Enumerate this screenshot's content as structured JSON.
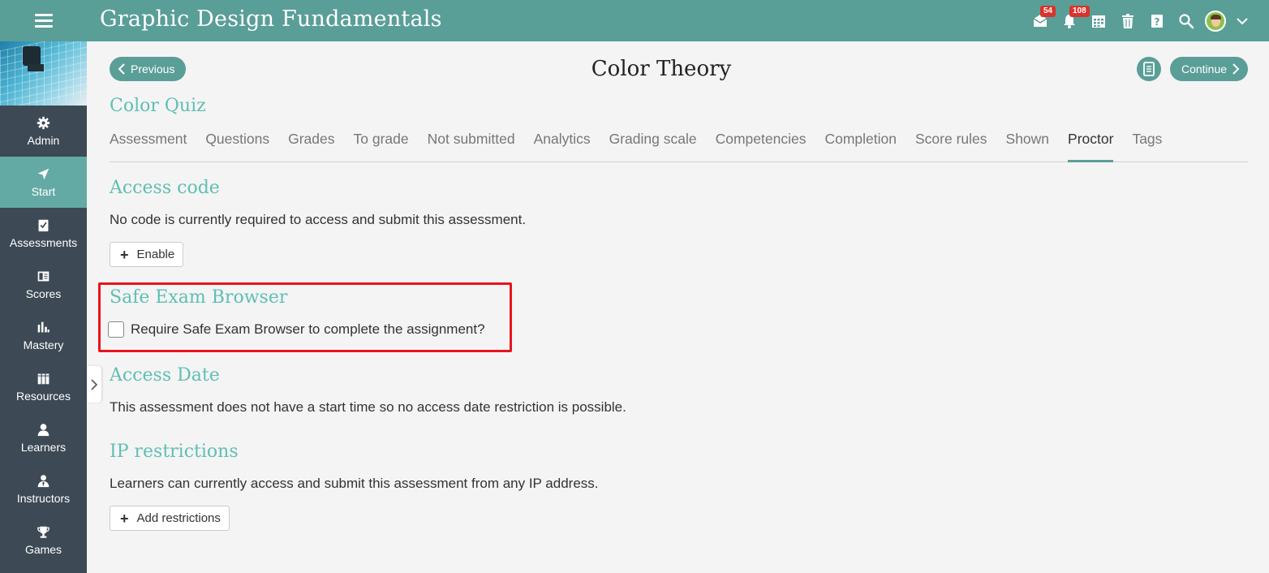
{
  "app": {
    "course_title": "Graphic Design Fundamentals",
    "accent_color": "#5a9e98",
    "sidebar_color": "#3d4a55"
  },
  "header_icons": [
    {
      "name": "mail-icon",
      "badge": "54"
    },
    {
      "name": "bell-icon",
      "badge": "108"
    },
    {
      "name": "calendar-icon",
      "badge": ""
    },
    {
      "name": "trash-icon",
      "badge": ""
    },
    {
      "name": "help-icon",
      "badge": ""
    },
    {
      "name": "search-icon",
      "badge": ""
    },
    {
      "name": "avatar",
      "badge": ""
    },
    {
      "name": "chevron-down-icon",
      "badge": ""
    }
  ],
  "sidebar": {
    "items": [
      {
        "label": "Admin",
        "icon": "gear-icon",
        "active": false
      },
      {
        "label": "Start",
        "icon": "navigation-arrow-icon",
        "active": true
      },
      {
        "label": "Assessments",
        "icon": "checklist-icon",
        "active": false
      },
      {
        "label": "Scores",
        "icon": "gradebook-icon",
        "active": false
      },
      {
        "label": "Mastery",
        "icon": "bar-chart-icon",
        "active": false
      },
      {
        "label": "Resources",
        "icon": "books-icon",
        "active": false
      },
      {
        "label": "Learners",
        "icon": "user-icon",
        "active": false
      },
      {
        "label": "Instructors",
        "icon": "instructor-icon",
        "active": false
      },
      {
        "label": "Games",
        "icon": "trophy-icon",
        "active": false
      }
    ]
  },
  "nav": {
    "previous_label": "Previous",
    "continue_label": "Continue"
  },
  "page": {
    "title": "Color Theory",
    "quiz_title": "Color Quiz"
  },
  "tabs": [
    "Assessment",
    "Questions",
    "Grades",
    "To grade",
    "Not submitted",
    "Analytics",
    "Grading scale",
    "Competencies",
    "Completion",
    "Score rules",
    "Shown",
    "Proctor",
    "Tags"
  ],
  "active_tab": "Proctor",
  "sections": {
    "access_code": {
      "title": "Access code",
      "text": "No code is currently required to access and submit this assessment.",
      "button": "Enable"
    },
    "safe_exam": {
      "title": "Safe Exam Browser",
      "checkbox_label": "Require Safe Exam Browser to complete the assignment?",
      "checked": false
    },
    "access_date": {
      "title": "Access Date",
      "text": "This assessment does not have a start time so no access date restriction is possible."
    },
    "ip_restrictions": {
      "title": "IP restrictions",
      "text": "Learners can currently access and submit this assessment from any IP address.",
      "button": "Add restrictions"
    }
  }
}
